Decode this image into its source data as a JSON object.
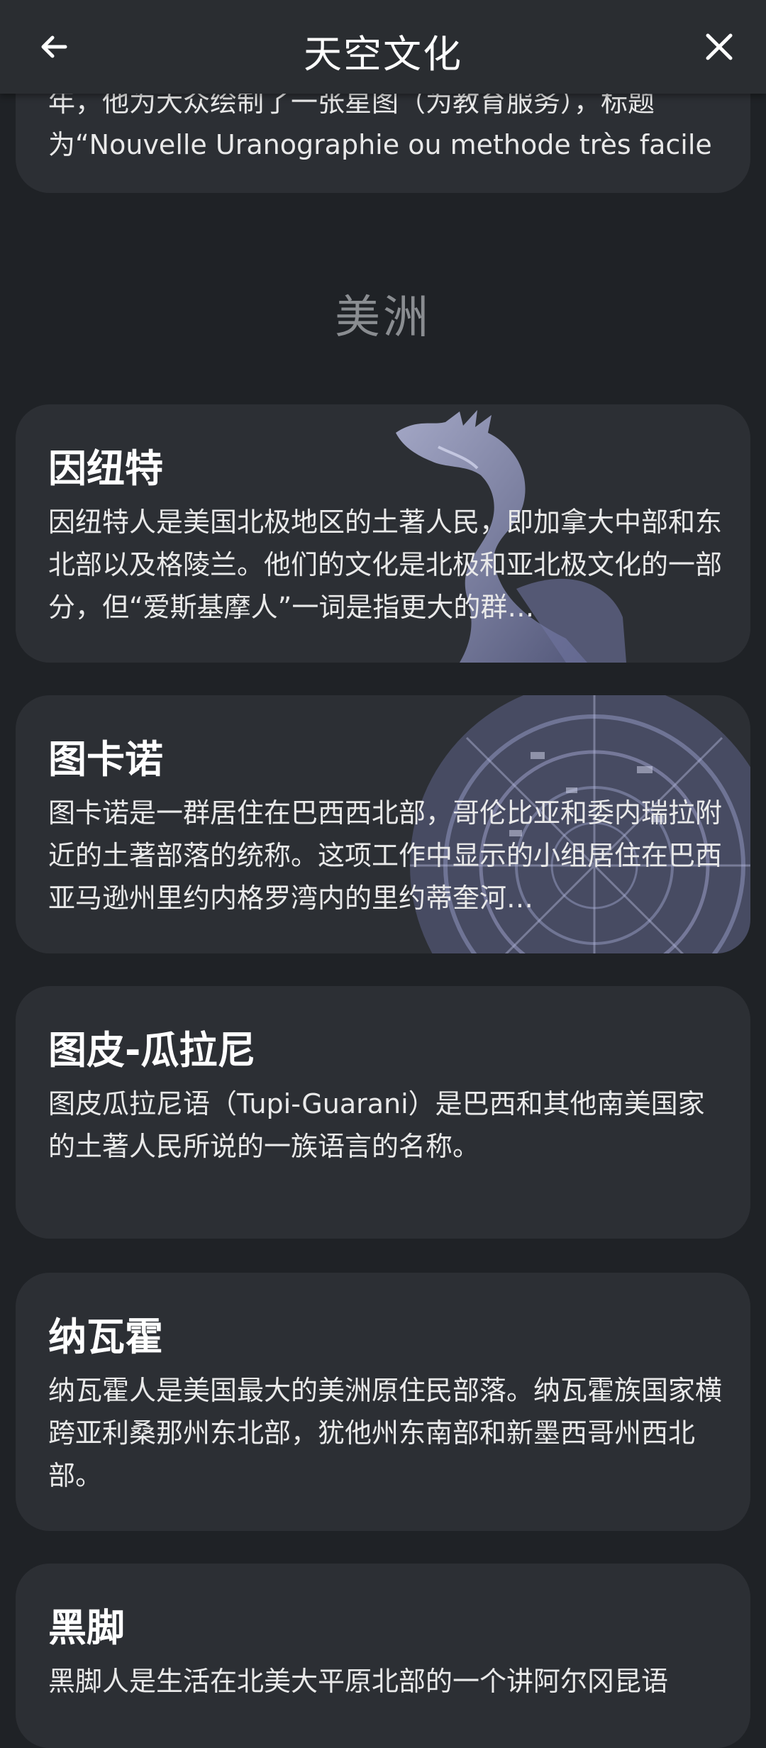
{
  "header": {
    "title": "天空文化",
    "back_icon": "arrow-left-icon",
    "close_icon": "close-icon"
  },
  "partial_card": {
    "text": "年，他为大众绘制了一张星图（为教育服务），标题为“Nouvelle Uranographie ou methode très facile …"
  },
  "section_title": "美洲",
  "cards": [
    {
      "title": "因纽特",
      "text": "因纽特人是美国北极地区的土著人民，即加拿大中部和东北部以及格陵兰。他们的文化是北极和亚北极文化的一部分，但“爱斯基摩人”一词是指更大的群…"
    },
    {
      "title": "图卡诺",
      "text": "图卡诺是一群居住在巴西西北部，哥伦比亚和委内瑞拉附近的土著部落的统称。这项工作中显示的小组居住在巴西亚马逊州里约内格罗湾内的里约蒂奎河…"
    },
    {
      "title": "图皮-瓜拉尼",
      "text": "图皮瓜拉尼语（Tupi-Guarani）是巴西和其他南美国家的土著人民所说的一族语言的名称。"
    },
    {
      "title": "纳瓦霍",
      "text": "纳瓦霍人是美国最大的美洲原住民部落。纳瓦霍族国家横跨亚利桑那州东北部，犹他州东南部和新墨西哥州西北部。"
    },
    {
      "title": "黑脚",
      "text": "黑脚人是生活在北美大平原北部的一个讲阿尔冈昆语"
    }
  ]
}
